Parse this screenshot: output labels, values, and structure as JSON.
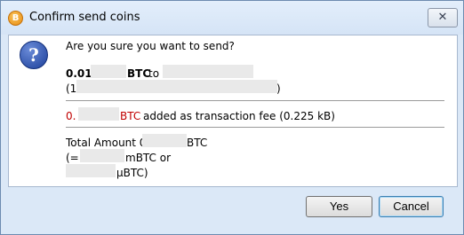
{
  "window": {
    "title": "Confirm send coins",
    "close_glyph": "✕",
    "app_icon_glyph": "B"
  },
  "icons": {
    "app": "bitcoin-icon",
    "question": "question-icon",
    "question_glyph": "?"
  },
  "message": {
    "question": "Are you sure you want to send?"
  },
  "send": {
    "amount_prefix": "0.01",
    "unit": "BTC",
    "to_label": "to",
    "paren_open": "(1",
    "paren_close": ")"
  },
  "fee": {
    "amount_prefix": "0.",
    "unit": "BTC",
    "suffix": "added as transaction fee (0.225 kB)"
  },
  "total": {
    "label": "Total Amount 0.",
    "unit": "BTC",
    "mbtc_prefix": "(=",
    "mbtc_suffix": "mBTC or",
    "ubtc_suffix": "μBTC)"
  },
  "buttons": {
    "yes": "Yes",
    "cancel": "Cancel"
  },
  "colors": {
    "fee_text": "#c00000",
    "accent_border": "#3c7fb1",
    "window_bg": "#dbe8f7"
  }
}
